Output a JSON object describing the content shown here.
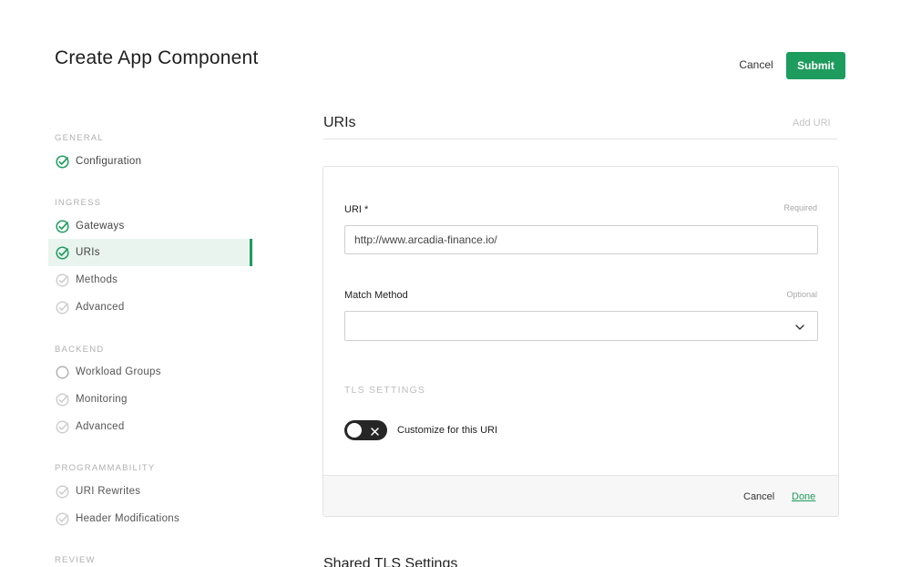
{
  "header": {
    "title": "Create App Component",
    "cancel_label": "Cancel",
    "submit_label": "Submit",
    "accent_color": "#1e9c5e"
  },
  "sidebar": {
    "sections": [
      {
        "label": "GENERAL",
        "items": [
          {
            "label": "Configuration",
            "status": "done",
            "icon": "check-circle-icon"
          }
        ]
      },
      {
        "label": "INGRESS",
        "items": [
          {
            "label": "Gateways",
            "status": "done",
            "icon": "check-circle-icon"
          },
          {
            "label": "URIs",
            "status": "done",
            "active": true,
            "icon": "check-circle-icon"
          },
          {
            "label": "Methods",
            "status": "pending",
            "icon": "check-circle-outline-icon"
          },
          {
            "label": "Advanced",
            "status": "pending",
            "icon": "check-circle-outline-icon"
          }
        ]
      },
      {
        "label": "BACKEND",
        "items": [
          {
            "label": "Workload Groups",
            "status": "empty",
            "icon": "empty-circle-icon"
          },
          {
            "label": "Monitoring",
            "status": "pending",
            "icon": "check-circle-outline-icon"
          },
          {
            "label": "Advanced",
            "status": "pending",
            "icon": "check-circle-outline-icon"
          }
        ]
      },
      {
        "label": "PROGRAMMABILITY",
        "items": [
          {
            "label": "URI Rewrites",
            "status": "pending",
            "icon": "check-circle-outline-icon"
          },
          {
            "label": "Header Modifications",
            "status": "pending",
            "icon": "check-circle-outline-icon"
          }
        ]
      },
      {
        "label": "REVIEW",
        "items": []
      }
    ]
  },
  "main": {
    "heading": "URIs",
    "add_uri_label": "Add URI",
    "card": {
      "uri_label": "URI *",
      "uri_hint": "Required",
      "uri_value": "http://www.arcadia-finance.io/",
      "match_method_label": "Match Method",
      "match_method_hint": "Optional",
      "match_method_value": "",
      "tls_settings_label": "TLS SETTINGS",
      "toggle_label": "Customize for this URI",
      "toggle_on": false,
      "footer_cancel": "Cancel",
      "footer_done": "Done"
    },
    "shared_tls_heading": "Shared TLS Settings"
  }
}
